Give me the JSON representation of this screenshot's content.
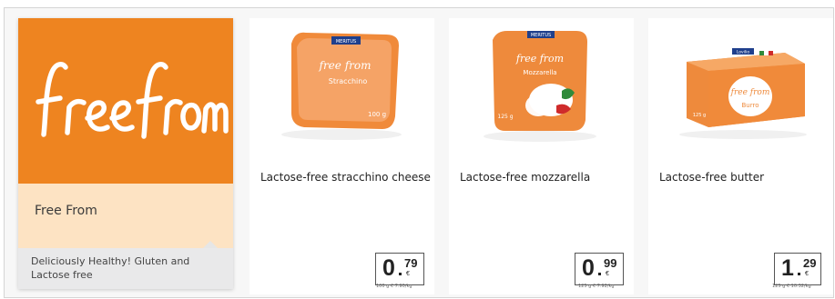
{
  "brand": {
    "logo_text": "free from",
    "name": "Free From",
    "description": "Deliciously Healthy! Gluten and Lactose free",
    "colors": {
      "primary": "#ee8420",
      "light": "#fde3c3",
      "grey": "#e9e9ea"
    }
  },
  "products": [
    {
      "name": "Lactose-free stracchino cheese",
      "price_int": "0",
      "price_dec": "79",
      "currency": "€",
      "unit_price": "100 g  € 7.90/kg",
      "package": {
        "brand_label": "MERITUS",
        "product_label": "Stracchino",
        "weight": "100 g"
      }
    },
    {
      "name": "Lactose-free mozzarella",
      "price_int": "0",
      "price_dec": "99",
      "currency": "€",
      "unit_price": "125 g  € 7.92/kg",
      "package": {
        "brand_label": "MERITUS",
        "product_label": "Mozzarella",
        "weight": "125 g"
      }
    },
    {
      "name": "Lactose-free butter",
      "price_int": "1",
      "price_dec": "29",
      "currency": "€",
      "unit_price": "125 g  € 10.32/kg",
      "package": {
        "brand_label": "Lovilio",
        "product_label": "Burro",
        "weight": "125 g"
      }
    }
  ]
}
